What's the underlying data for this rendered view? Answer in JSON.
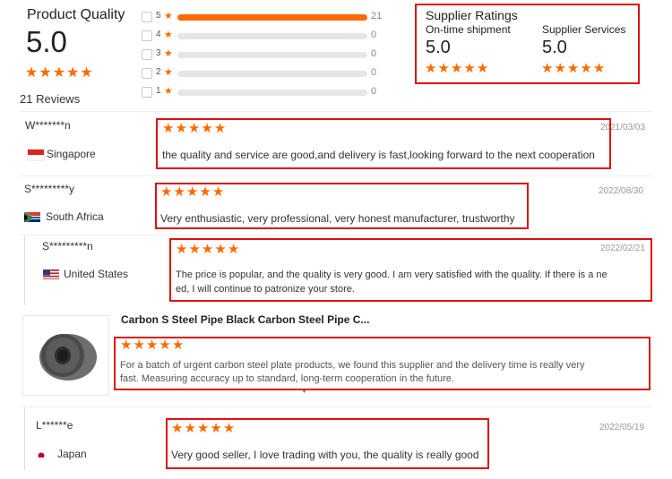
{
  "summary": {
    "title": "Product Quality",
    "score": "5.0",
    "reviews": "21 Reviews",
    "distribution": [
      {
        "stars": "5",
        "count": "21",
        "fraction": 1.0
      },
      {
        "stars": "4",
        "count": "0",
        "fraction": 0
      },
      {
        "stars": "3",
        "count": "0",
        "fraction": 0
      },
      {
        "stars": "2",
        "count": "0",
        "fraction": 0
      },
      {
        "stars": "1",
        "count": "0",
        "fraction": 0
      }
    ]
  },
  "supplier": {
    "title": "Supplier Ratings",
    "ontime_label": "On-time shipment",
    "ontime_score": "5.0",
    "services_label": "Supplier Services",
    "services_score": "5.0"
  },
  "reviews": [
    {
      "name": "W*******n",
      "country": "Singapore",
      "date": "2021/03/03",
      "text": "the quality and service are good,and delivery is fast,looking forward to the next cooperation"
    },
    {
      "name": "S*********y",
      "country": "South Africa",
      "date": "2022/08/30",
      "text": "Very enthusiastic, very professional, very honest manufacturer, trustworthy"
    },
    {
      "name": "S*********n",
      "country": "United States",
      "date": "2022/02/21",
      "text_line1": "The price is popular, and the quality is very good. I am very satisfied with the quality. If there is a ne",
      "text_line2": "ed, I will continue to patronize your store."
    },
    {
      "product_title": "Carbon S Steel Pipe Black Carbon Steel Pipe C...",
      "text_line1": "For a batch of urgent carbon steel plate products, we found this supplier and the delivery time is really very",
      "text_line2": "fast.   Measuring accuracy up to standard, long-term cooperation in the future."
    },
    {
      "name": "L******e",
      "country": "Japan",
      "date": "2022/05/19",
      "text": "Very good seller, I love trading with you, the quality is really good"
    }
  ],
  "colors": {
    "accent": "#ff6a00",
    "highlight": "#e01010"
  },
  "icons": {
    "star": "star-icon",
    "checkbox": "checkbox",
    "flag_sg": "flag-singapore-icon",
    "flag_za": "flag-south-africa-icon",
    "flag_us": "flag-united-states-icon",
    "flag_jp": "flag-japan-icon",
    "expand": "caret-down-icon"
  }
}
